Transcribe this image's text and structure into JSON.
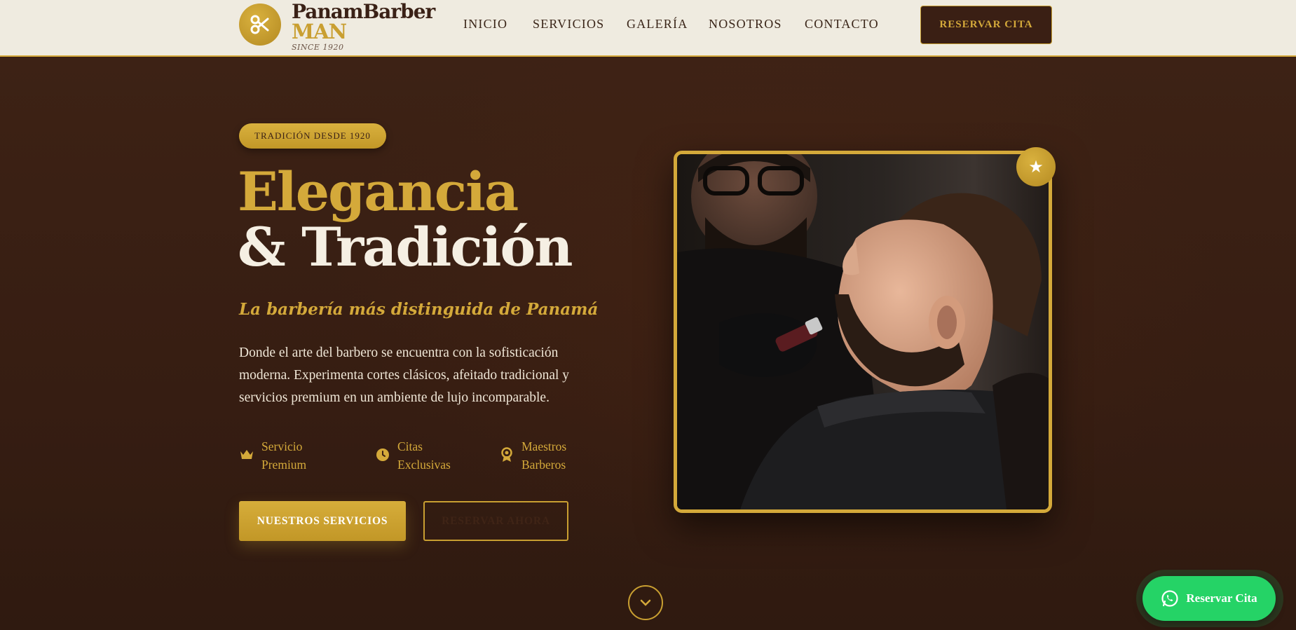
{
  "nav": {
    "brand_name": "PanamBarber",
    "brand_sub": "MAN",
    "brand_since": "SINCE 1920",
    "logo_icon": "scissors-icon",
    "links": [
      "INICIO",
      "SERVICIOS",
      "GALERÍA",
      "NOSOTROS",
      "CONTACTO"
    ],
    "cta_label": "RESERVAR CITA"
  },
  "hero": {
    "badge": "TRADICIÓN DESDE 1920",
    "title_line1": "Elegancia",
    "title_line2": "& Tradición",
    "subtitle": "La barbería más distinguida de Panamá",
    "description": "Donde el arte del barbero se encuentra con la sofisticación moderna. Experimenta cortes clásicos, afeitado tradicional y servicios premium en un ambiente de lujo incomparable.",
    "features": [
      {
        "icon": "crown-icon",
        "line1": "Servicio",
        "line2": "Premium"
      },
      {
        "icon": "clock-icon",
        "line1": "Citas",
        "line2": "Exclusivas"
      },
      {
        "icon": "award-icon",
        "line1": "Maestros",
        "line2": "Barberos"
      }
    ],
    "primary_button": "NUESTROS SERVICIOS",
    "secondary_button": "RESERVAR AHORA",
    "photo_badge_icon": "star-icon"
  },
  "floating": {
    "scroll_icon": "chevron-down-icon",
    "whatsapp_label": "Reservar Cita",
    "whatsapp_icon": "whatsapp-icon"
  },
  "colors": {
    "gold": "#d4a93a",
    "dark_brown": "#3a2014",
    "cream": "#efebe0",
    "whatsapp_green": "#25d366"
  }
}
